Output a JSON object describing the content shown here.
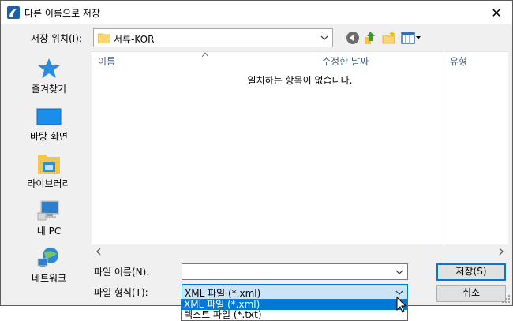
{
  "window": {
    "title": "다른 이름으로 저장",
    "close_glyph": "✕"
  },
  "location": {
    "label": "저장 위치(I):",
    "value": "서류-KOR"
  },
  "toolbar": {
    "icons": [
      "back-icon",
      "up-folder-icon",
      "new-folder-icon",
      "view-menu-icon"
    ]
  },
  "places": [
    {
      "label": "즐겨찾기",
      "icon": "star-icon"
    },
    {
      "label": "바탕 화면",
      "icon": "desktop-icon"
    },
    {
      "label": "라이브러리",
      "icon": "library-icon"
    },
    {
      "label": "내 PC",
      "icon": "computer-icon"
    },
    {
      "label": "네트워크",
      "icon": "network-icon"
    }
  ],
  "file_list": {
    "columns": [
      "이름",
      "수정한 날짜",
      "유형"
    ],
    "empty_message": "일치하는 항목이 없습니다."
  },
  "filename": {
    "label": "파일 이름(N):",
    "value": ""
  },
  "filetype": {
    "label": "파일 형식(T):",
    "value": "XML 파일 (*.xml)",
    "options": [
      "XML 파일 (*.xml)",
      "텍스트 파일 (*.txt)"
    ]
  },
  "buttons": {
    "save": "저장(S)",
    "cancel": "취소"
  },
  "colors": {
    "accent": "#0078d7",
    "selection_bg": "#cce4f7",
    "column_header": "#4c607a"
  }
}
